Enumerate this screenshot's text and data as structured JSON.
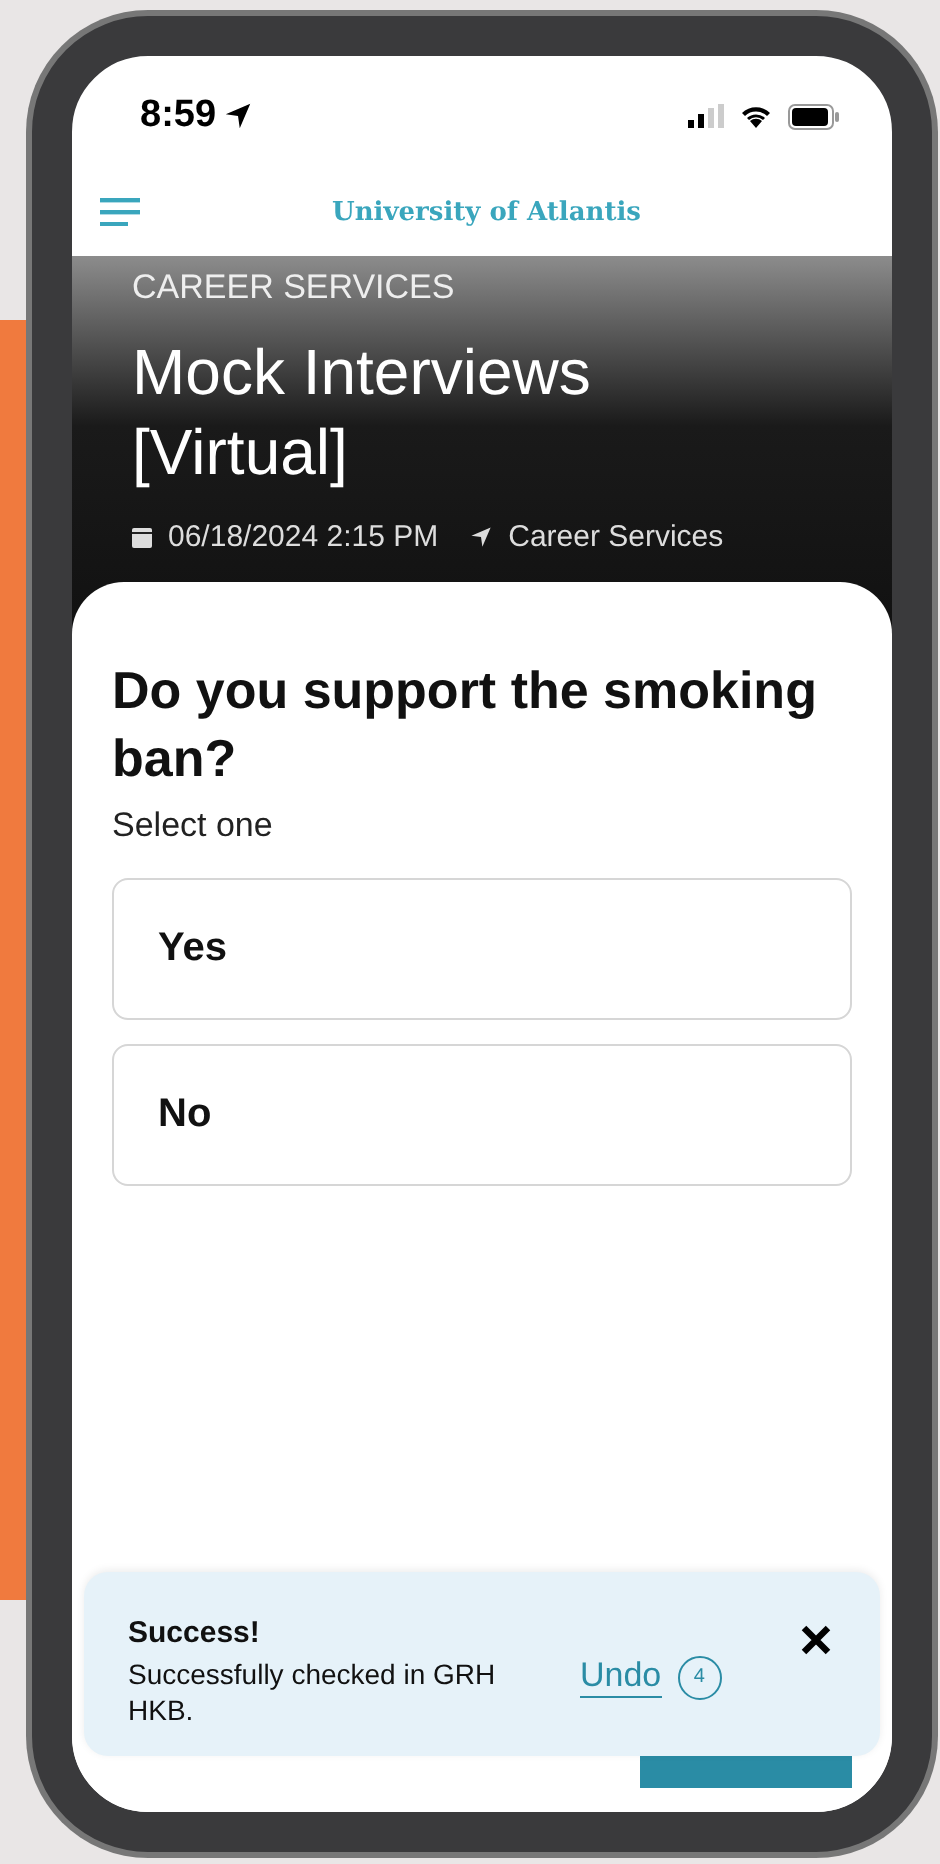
{
  "status_bar": {
    "time": "8:59"
  },
  "nav": {
    "title": "University of Atlantis"
  },
  "header": {
    "category": "CAREER SERVICES",
    "title": "Mock Interviews [Virtual]",
    "date": "06/18/2024 2:15 PM",
    "location": "Career Services"
  },
  "question": {
    "title": "Do you support the smoking ban?",
    "hint": "Select one",
    "options": [
      {
        "label": "Yes",
        "selected": false
      },
      {
        "label": "No",
        "selected": false
      }
    ]
  },
  "toast": {
    "title": "Success!",
    "message": "Successfully checked in GRH HKB.",
    "action": "Undo",
    "countdown": "4"
  }
}
